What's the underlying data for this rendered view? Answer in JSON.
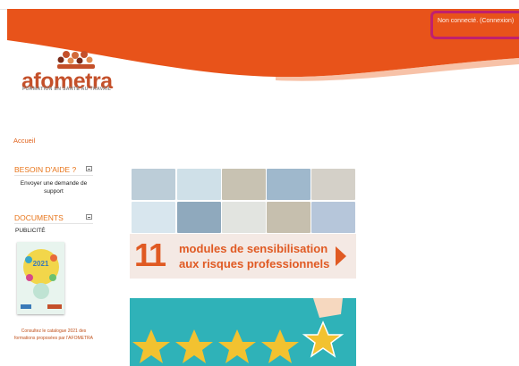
{
  "header": {
    "login_status": "Non connecté.",
    "login_link": "(Connexion)",
    "brand_color": "#e8531a",
    "logo": {
      "word": "afometra",
      "tagline": "FORMATION EN SANTÉ AU TRAVAIL"
    }
  },
  "breadcrumb": {
    "home": "Accueil"
  },
  "sidebar": {
    "help_block": {
      "title": "BESOIN D'AIDE ?",
      "link": "Envoyer une demande de support"
    },
    "documents_block": {
      "title": "DOCUMENTS",
      "label": "PUBLICITÉ",
      "catalog_year": "2021",
      "caption": "Consultez le catalogue 2021 des formations proposées par l'AFOMETRA"
    }
  },
  "main": {
    "banner1": {
      "number": "11",
      "line1": "modules de sensibilisation",
      "line2": "aux risques professionnels"
    },
    "banner2": {
      "star_count": 5,
      "accent": "#2fb2b8"
    }
  }
}
